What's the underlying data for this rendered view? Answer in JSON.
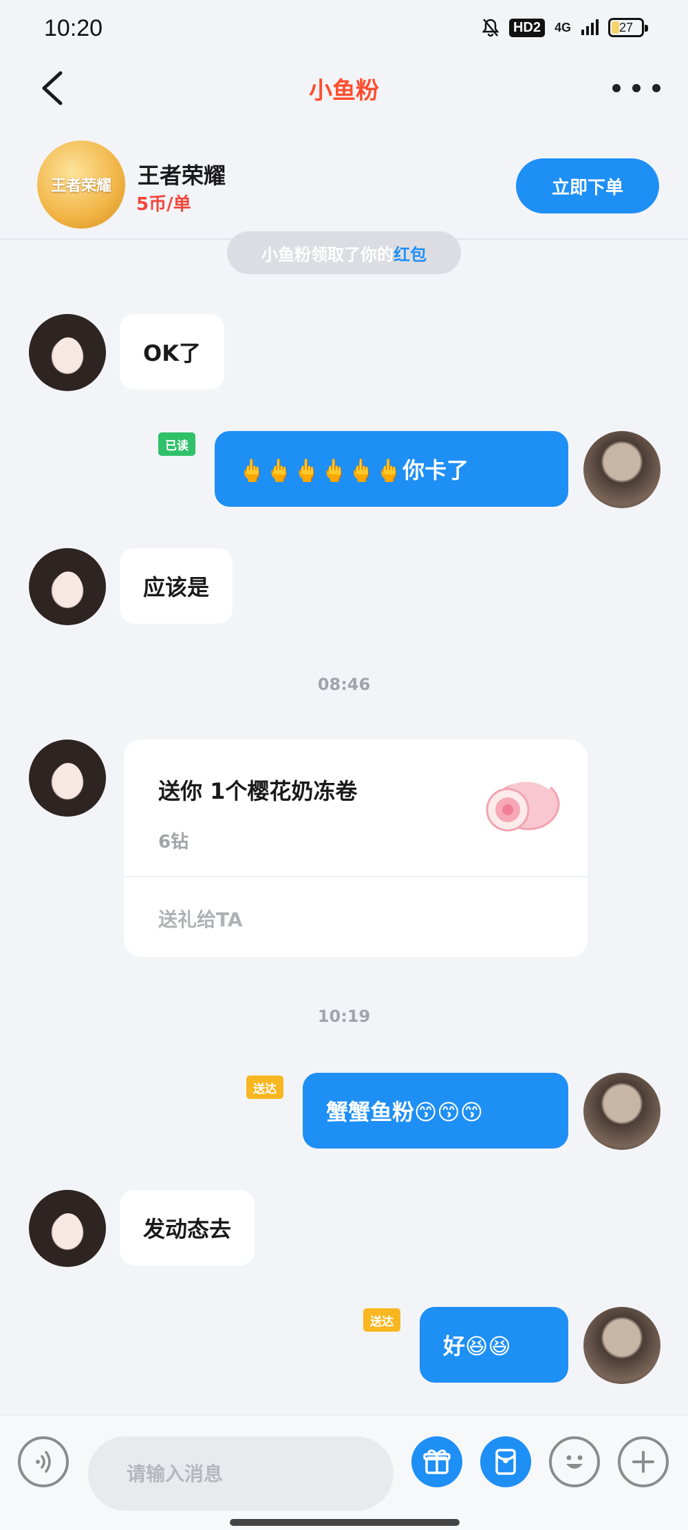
{
  "status_bar": {
    "time": "10:20",
    "hd": "HD2",
    "network": "4G",
    "battery": "27",
    "battery_level": 0.27
  },
  "nav": {
    "title": "小鱼粉"
  },
  "service": {
    "game_name": "王者荣耀",
    "price": "5币/单",
    "order_button": "立即下单",
    "logo_text": "王者荣耀"
  },
  "system_notice": {
    "prefix": "小鱼粉领取了你的",
    "highlight": "红包"
  },
  "messages": [
    {
      "text": "OK了"
    },
    {
      "text": "🖕🖕🖕🖕🖕🖕你卡了",
      "status": "已读"
    },
    {
      "text": "应该是"
    },
    {
      "text": "蟹蟹鱼粉😙😙😙",
      "status": "送达"
    },
    {
      "text": "发动态去"
    },
    {
      "text": "好😆😆",
      "status": "送达"
    }
  ],
  "timestamps": [
    "08:46",
    "10:19"
  ],
  "gift": {
    "title": "送你 1个樱花奶冻卷",
    "price": "6钻",
    "action": "送礼给TA"
  },
  "input": {
    "placeholder": "请输入消息",
    "value": ""
  },
  "colors": {
    "accent": "#1e8ff5",
    "title_red": "#ff4d2e",
    "read_tag": "#30c06a",
    "sent_tag": "#f8b620",
    "price_red": "#f0463c"
  },
  "icons": [
    "back-arrow-icon",
    "more-dots-icon",
    "voice-icon",
    "gift-icon",
    "red-packet-icon",
    "emoji-icon",
    "plus-icon"
  ]
}
